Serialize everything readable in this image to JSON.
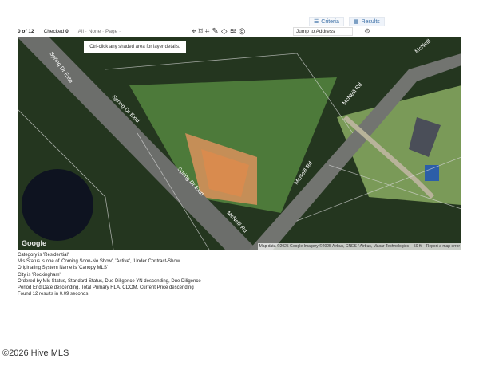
{
  "tabs": [
    {
      "label": "Criteria",
      "icon": "sliders-icon"
    },
    {
      "label": "Results",
      "icon": "grid-icon",
      "active": true
    }
  ],
  "toolbar": {
    "count": "0 of 12",
    "checked_label": "Checked",
    "checked_value": "0",
    "select_all": "All",
    "select_none": "None",
    "select_page": "Page",
    "jump_placeholder": "Jump to Address"
  },
  "map": {
    "tooltip": "Ctrl-click any shaded area for layer details.",
    "roads": [
      "Spring Dr Extd",
      "Spring Dr Extd",
      "Spring Dr Extd",
      "McNeill Rd",
      "McNeill Rd",
      "McNeill Rd"
    ],
    "logo": "Google",
    "attribution": "Map data ©2025 Google Imagery ©2025 Airbus, CNES / Airbus, Maxar Technologies",
    "scale": "50 ft",
    "report": "Report a map error"
  },
  "criteria": [
    "Category is 'Residential'",
    "Mls Status is one of 'Coming Soon-No Show', 'Active', 'Under Contract-Show'",
    "Originating System Name is 'Canopy MLS'",
    "City is 'Rockingham'",
    "Ordered by Mls Status, Standard Status, Due Diligence YN descending, Due Diligence",
    "Period End Date descending, Total Primary HLA, CDOM, Current Price descending",
    "Found 12 results in 0.09 seconds."
  ],
  "footer": "©2026 Hive MLS"
}
